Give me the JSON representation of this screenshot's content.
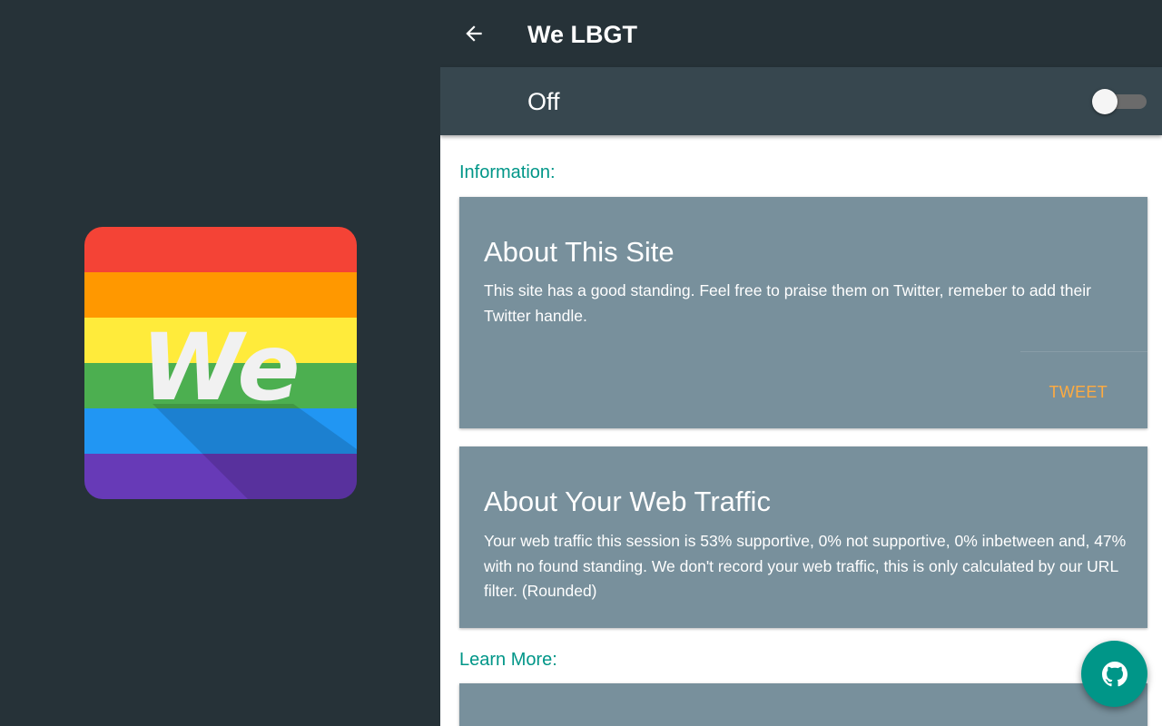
{
  "app_bar": {
    "title": "We LBGT"
  },
  "toggle": {
    "label": "Off",
    "state": "off"
  },
  "logo": {
    "text": "We"
  },
  "sections": {
    "information_label": "Information:",
    "learn_more_label": "Learn More:"
  },
  "cards": {
    "about_site": {
      "title": "About This Site",
      "body": "This site has a good standing. Feel free to praise them on Twitter, remeber to add their Twitter handle.",
      "action_label": "TWEET"
    },
    "about_traffic": {
      "title": "About Your Web Traffic",
      "body": "Your web traffic this session is 53% supportive, 0% not supportive, 0% inbetween and, 47% with no found standing. We don't record your web traffic, this is only calculated by our URL filter. (Rounded)"
    }
  },
  "icons": {
    "back": "arrow-back-icon",
    "fab": "github-icon"
  },
  "colors": {
    "dark_background": "#263238",
    "toggle_bar": "#37474f",
    "card": "#78909c",
    "accent_teal": "#009688",
    "tweet_orange": "#ffab40"
  }
}
